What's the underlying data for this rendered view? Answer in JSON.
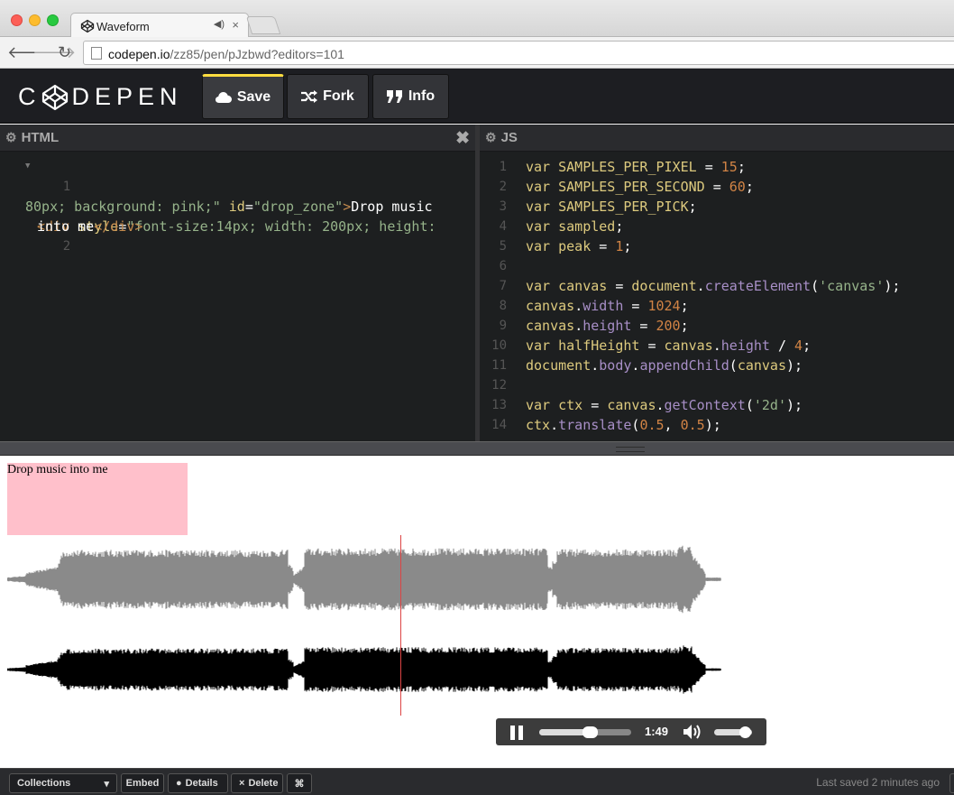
{
  "browser": {
    "tab_title": "Waveform",
    "tab_audio_icon": "speaker-icon",
    "close_glyph": "×",
    "url_domain": "codepen.io",
    "url_path": "/zz85/pen/pJzbwd?editors=101"
  },
  "header": {
    "logo_text_left": "C",
    "logo_text_right": "DEPEN",
    "buttons": {
      "save": "Save",
      "fork": "Fork",
      "info": "Info"
    }
  },
  "html_editor": {
    "title": "HTML",
    "close_glyph": "✖",
    "line_numbers": [
      "1",
      "2"
    ],
    "code": {
      "l1_open": "<div ",
      "l1_attr_style": "style",
      "l1_eq": "=",
      "l1_style_val": "\"font-size:14px; width: 200px; height:",
      "l2_style_val": "80px; background: pink;\"",
      "l2_attr_id": "id",
      "l2_eq": "=",
      "l2_id_val": "\"drop_zone\"",
      "l2_gt": ">",
      "l2_text": "Drop music",
      "l3_text": "into me",
      "l3_close": "</div>"
    }
  },
  "js_editor": {
    "title": "JS",
    "lines": [
      {
        "n": "1",
        "parts": [
          [
            "k",
            "var SAMPLES_PER_PIXEL "
          ],
          [
            "txt",
            "= "
          ],
          [
            "num",
            "15"
          ],
          [
            "txt",
            ";"
          ]
        ]
      },
      {
        "n": "2",
        "parts": [
          [
            "k",
            "var SAMPLES_PER_SECOND "
          ],
          [
            "txt",
            "= "
          ],
          [
            "num",
            "60"
          ],
          [
            "txt",
            ";"
          ]
        ]
      },
      {
        "n": "3",
        "parts": [
          [
            "k",
            "var SAMPLES_PER_PICK"
          ],
          [
            "txt",
            ";"
          ]
        ]
      },
      {
        "n": "4",
        "parts": [
          [
            "k",
            "var sampled"
          ],
          [
            "txt",
            ";"
          ]
        ]
      },
      {
        "n": "5",
        "parts": [
          [
            "k",
            "var peak "
          ],
          [
            "txt",
            "= "
          ],
          [
            "num",
            "1"
          ],
          [
            "txt",
            ";"
          ]
        ]
      },
      {
        "n": "6",
        "parts": []
      },
      {
        "n": "7",
        "parts": [
          [
            "k",
            "var canvas "
          ],
          [
            "txt",
            "= "
          ],
          [
            "k",
            "document"
          ],
          [
            "txt",
            "."
          ],
          [
            "prop",
            "createElement"
          ],
          [
            "txt",
            "("
          ],
          [
            "str",
            "'canvas'"
          ],
          [
            "txt",
            ");"
          ]
        ]
      },
      {
        "n": "8",
        "parts": [
          [
            "k",
            "canvas"
          ],
          [
            "txt",
            "."
          ],
          [
            "prop",
            "width"
          ],
          [
            "txt",
            " = "
          ],
          [
            "num",
            "1024"
          ],
          [
            "txt",
            ";"
          ]
        ]
      },
      {
        "n": "9",
        "parts": [
          [
            "k",
            "canvas"
          ],
          [
            "txt",
            "."
          ],
          [
            "prop",
            "height"
          ],
          [
            "txt",
            " = "
          ],
          [
            "num",
            "200"
          ],
          [
            "txt",
            ";"
          ]
        ]
      },
      {
        "n": "10",
        "parts": [
          [
            "k",
            "var halfHeight "
          ],
          [
            "txt",
            "= "
          ],
          [
            "k",
            "canvas"
          ],
          [
            "txt",
            "."
          ],
          [
            "prop",
            "height"
          ],
          [
            "txt",
            " / "
          ],
          [
            "num",
            "4"
          ],
          [
            "txt",
            ";"
          ]
        ]
      },
      {
        "n": "11",
        "parts": [
          [
            "k",
            "document"
          ],
          [
            "txt",
            "."
          ],
          [
            "prop",
            "body"
          ],
          [
            "txt",
            "."
          ],
          [
            "prop",
            "appendChild"
          ],
          [
            "txt",
            "("
          ],
          [
            "k",
            "canvas"
          ],
          [
            "txt",
            ");"
          ]
        ]
      },
      {
        "n": "12",
        "parts": []
      },
      {
        "n": "13",
        "parts": [
          [
            "k",
            "var ctx "
          ],
          [
            "txt",
            "= "
          ],
          [
            "k",
            "canvas"
          ],
          [
            "txt",
            "."
          ],
          [
            "prop",
            "getContext"
          ],
          [
            "txt",
            "("
          ],
          [
            "str",
            "'2d'"
          ],
          [
            "txt",
            ");"
          ]
        ]
      },
      {
        "n": "14",
        "parts": [
          [
            "k",
            "ctx"
          ],
          [
            "txt",
            "."
          ],
          [
            "prop",
            "translate"
          ],
          [
            "txt",
            "("
          ],
          [
            "num",
            "0.5"
          ],
          [
            "txt",
            ", "
          ],
          [
            "num",
            "0.5"
          ],
          [
            "txt",
            ");"
          ]
        ]
      }
    ]
  },
  "preview": {
    "drop_zone_text": "Drop music into me",
    "drop_zone_color": "#ffc0cb",
    "playhead_color": "#dd4444",
    "playhead_position": 0.55,
    "audio": {
      "time": "1:49",
      "progress": 0.55,
      "volume": 0.8
    }
  },
  "footer": {
    "collections": "Collections",
    "embed": "Embed",
    "details": "Details",
    "delete": "Delete",
    "delete_glyph": "×",
    "cmd_glyph": "⌘",
    "last_saved": "Last saved 2 minutes ago"
  }
}
